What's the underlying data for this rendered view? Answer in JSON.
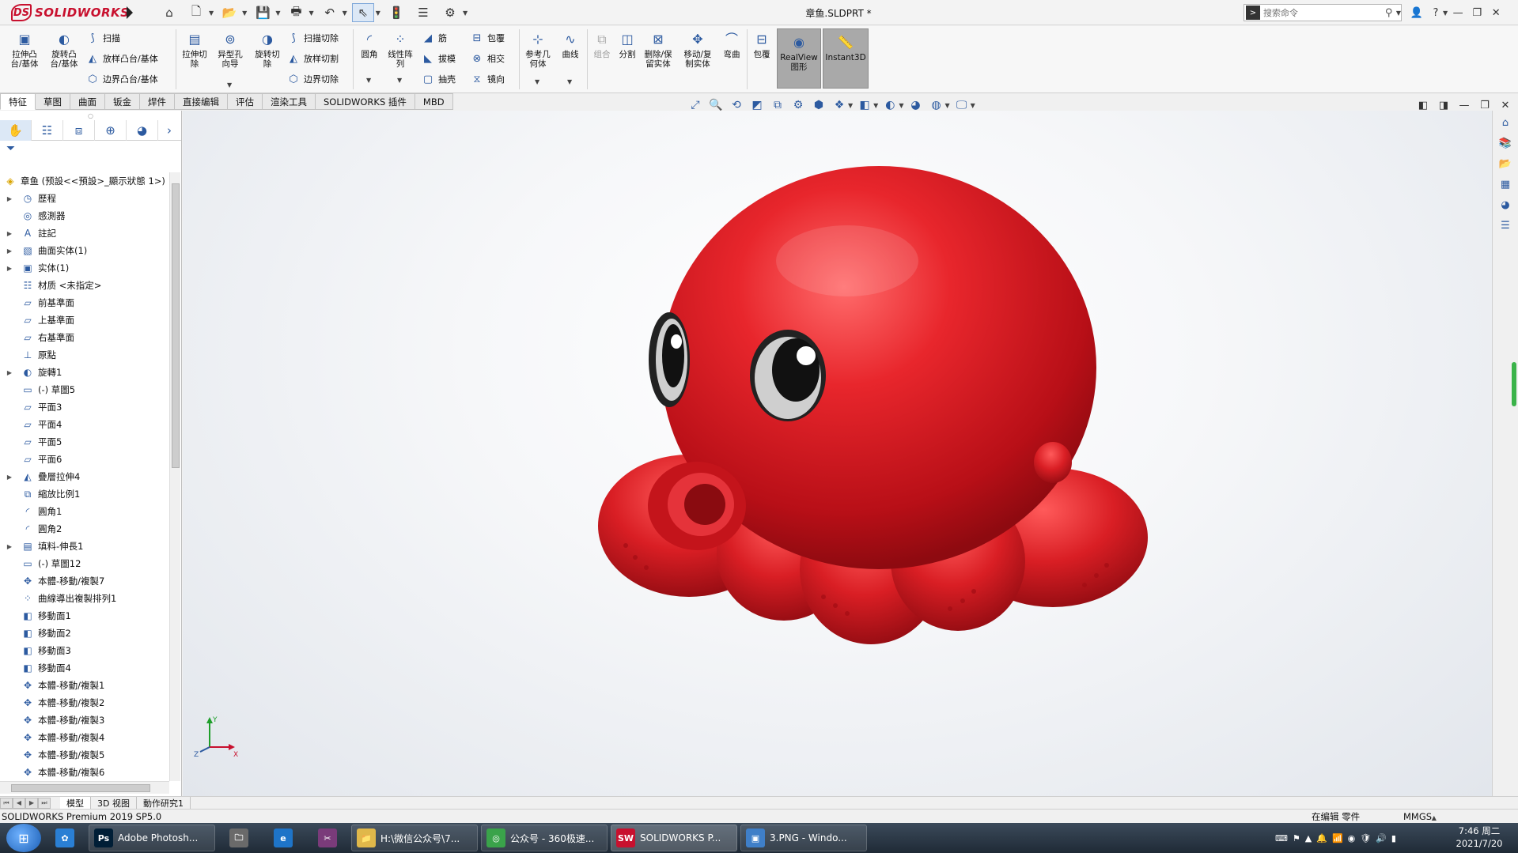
{
  "titlebar": {
    "brand": "SOLIDWORKS",
    "doc_title": "章鱼.SLDPRT *",
    "search_placeholder": "搜索命令",
    "quick_access": [
      "home-icon",
      "new-doc-icon",
      "open-icon",
      "save-icon",
      "print-icon",
      "undo-icon",
      "select-icon",
      "rebuild-icon",
      "file-props-icon",
      "options-icon"
    ]
  },
  "ribbon": {
    "extrude_boss": "拉伸凸\n台/基体",
    "revolve_boss": "旋转凸\n台/基体",
    "sweep": "扫描",
    "loft_boss": "放样凸台/基体",
    "boundary_boss": "边界凸台/基体",
    "extrude_cut": "拉伸切\n除",
    "hole_wizard": "异型孔\n向导",
    "revolve_cut": "旋转切\n除",
    "sweep_cut": "扫描切除",
    "loft_cut": "放样切割",
    "boundary_cut": "边界切除",
    "fillet": "圆角",
    "linear_pattern": "线性阵\n列",
    "rib": "筋",
    "draft": "拔模",
    "shell": "抽壳",
    "wrap": "包覆",
    "intersect": "相交",
    "mirror": "镜向",
    "ref_geometry": "参考几\n何体",
    "curves": "曲线",
    "combine": "组合",
    "split": "分割",
    "delete_keep_body": "删除/保\n留实体",
    "move_copy_body": "移动/复\n制实体",
    "flex": "弯曲",
    "wrap2": "包覆",
    "realview": "RealView\n图形",
    "instant3d": "Instant3D"
  },
  "tabs": [
    "特征",
    "草图",
    "曲面",
    "钣金",
    "焊件",
    "直接编辑",
    "评估",
    "渲染工具",
    "SOLIDWORKS 插件",
    "MBD"
  ],
  "tree": {
    "root": "章鱼 (预設<<預設>_顯示狀態 1>)",
    "items": [
      {
        "label": "歷程",
        "expand": true
      },
      {
        "label": "感測器",
        "expand": false
      },
      {
        "label": "註記",
        "expand": true
      },
      {
        "label": "曲面实体(1)",
        "expand": true
      },
      {
        "label": "实体(1)",
        "expand": true
      },
      {
        "label": "材质 <未指定>",
        "expand": false
      },
      {
        "label": "前基準面",
        "expand": false
      },
      {
        "label": "上基準面",
        "expand": false
      },
      {
        "label": "右基準面",
        "expand": false
      },
      {
        "label": "原點",
        "expand": false
      },
      {
        "label": "旋轉1",
        "expand": true
      },
      {
        "label": "(-) 草圖5",
        "expand": false
      },
      {
        "label": "平面3",
        "expand": false
      },
      {
        "label": "平面4",
        "expand": false
      },
      {
        "label": "平面5",
        "expand": false
      },
      {
        "label": "平面6",
        "expand": false
      },
      {
        "label": "疊層拉伸4",
        "expand": true
      },
      {
        "label": "縮放比例1",
        "expand": false
      },
      {
        "label": "圓角1",
        "expand": false
      },
      {
        "label": "圓角2",
        "expand": false
      },
      {
        "label": "填料-伸長1",
        "expand": true
      },
      {
        "label": "(-) 草圖12",
        "expand": false
      },
      {
        "label": "本體-移動/複製7",
        "expand": false
      },
      {
        "label": "曲線導出複製排列1",
        "expand": false
      },
      {
        "label": "移動面1",
        "expand": false
      },
      {
        "label": "移動面2",
        "expand": false
      },
      {
        "label": "移動面3",
        "expand": false
      },
      {
        "label": "移動面4",
        "expand": false
      },
      {
        "label": "本體-移動/複製1",
        "expand": false
      },
      {
        "label": "本體-移動/複製2",
        "expand": false
      },
      {
        "label": "本體-移動/複製3",
        "expand": false
      },
      {
        "label": "本體-移動/複製4",
        "expand": false
      },
      {
        "label": "本體-移動/複製5",
        "expand": false
      },
      {
        "label": "本體-移動/複製6",
        "expand": false
      }
    ]
  },
  "bottom_tabs": [
    "模型",
    "3D 视图",
    "動作研究1"
  ],
  "status": {
    "left": "SOLIDWORKS Premium 2019 SP5.0",
    "editing": "在编辑 零件",
    "units": "MMGS"
  },
  "taskbar": {
    "windows": [
      {
        "label": "Adobe Photosh...",
        "icon_text": "Ps",
        "color": "#001e36"
      },
      {
        "label": "H:\\微信公众号\\7...",
        "icon_text": "📁",
        "color": "#e0b84a"
      },
      {
        "label": "公众号 - 360极速...",
        "icon_text": "◎",
        "color": "#3aa34a"
      },
      {
        "label": "SOLIDWORKS P...",
        "icon_text": "SW",
        "color": "#c8102e"
      },
      {
        "label": "3.PNG - Windo...",
        "icon_text": "▣",
        "color": "#3f7fc8"
      }
    ],
    "clock_time": "7:46 周二",
    "clock_date": "2021/7/20"
  },
  "colors": {
    "octopus": "#d91e24",
    "brand_red": "#c8102e",
    "accent_blue": "#2c5aa0"
  }
}
